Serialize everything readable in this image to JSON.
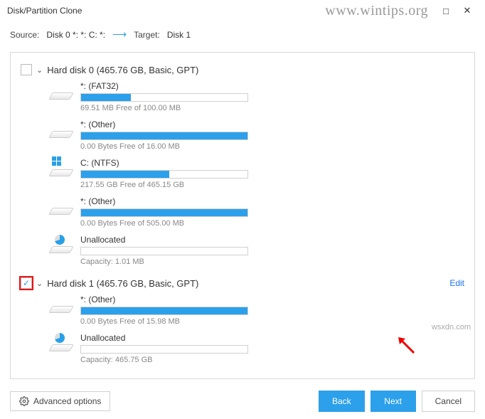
{
  "window": {
    "title": "Disk/Partition Clone"
  },
  "watermark": "www.wintips.org",
  "wsx": "wsxdn.com",
  "source_row": {
    "source_label": "Source:",
    "source_value": "Disk 0 *: *: C: *:",
    "target_label": "Target:",
    "target_value": "Disk 1"
  },
  "disk0": {
    "title": "Hard disk 0 (465.76 GB, Basic, GPT)",
    "parts": [
      {
        "name": "*: (FAT32)",
        "info": "69.51 MB Free of 100.00 MB",
        "fill": 30
      },
      {
        "name": "*: (Other)",
        "info": "0.00 Bytes Free of 16.00 MB",
        "fill": 100
      },
      {
        "name": "C: (NTFS)",
        "info": "217.55 GB Free of 465.15 GB",
        "fill": 53
      },
      {
        "name": "*: (Other)",
        "info": "0.00 Bytes Free of 505.00 MB",
        "fill": 100
      },
      {
        "name": "Unallocated",
        "info": "Capacity: 1.01 MB",
        "fill": 0
      }
    ]
  },
  "disk1": {
    "title": "Hard disk 1 (465.76 GB, Basic, GPT)",
    "edit": "Edit",
    "parts": [
      {
        "name": "*: (Other)",
        "info": "0.00 Bytes Free of 15.98 MB",
        "fill": 100
      },
      {
        "name": "Unallocated",
        "info": "Capacity: 465.75 GB",
        "fill": 0
      }
    ]
  },
  "footer": {
    "advanced": "Advanced options",
    "back": "Back",
    "next": "Next",
    "cancel": "Cancel"
  }
}
